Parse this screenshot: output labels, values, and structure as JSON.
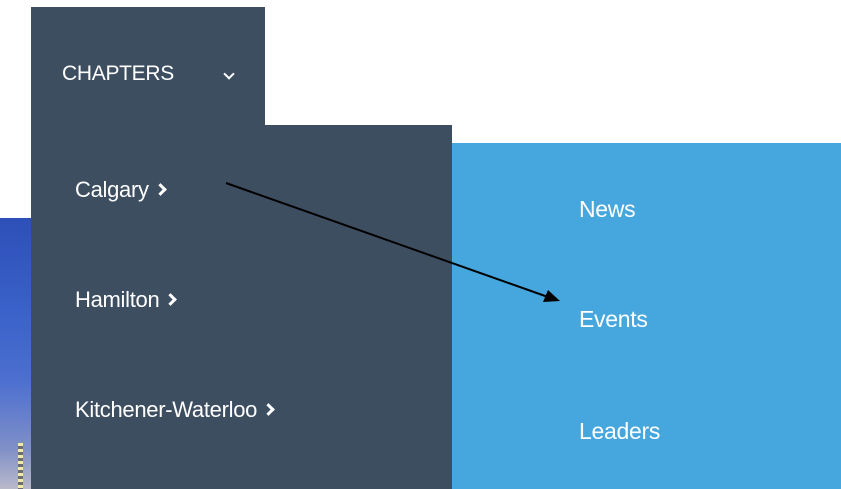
{
  "nav": {
    "top_label": "CHAPTERS",
    "top_icon": "chevron-down-icon",
    "items": [
      {
        "label": "Calgary",
        "icon": "chevron-right-icon"
      },
      {
        "label": "Hamilton",
        "icon": "chevron-right-icon"
      },
      {
        "label": "Kitchener-Waterloo",
        "icon": "chevron-right-icon"
      }
    ],
    "submenu": [
      {
        "label": "News"
      },
      {
        "label": "Events"
      },
      {
        "label": "Leaders"
      }
    ]
  },
  "colors": {
    "menu_bg": "#3d4e61",
    "submenu_bg": "#46a7de",
    "text": "#ffffff",
    "annotation_arrow": "#000000"
  }
}
